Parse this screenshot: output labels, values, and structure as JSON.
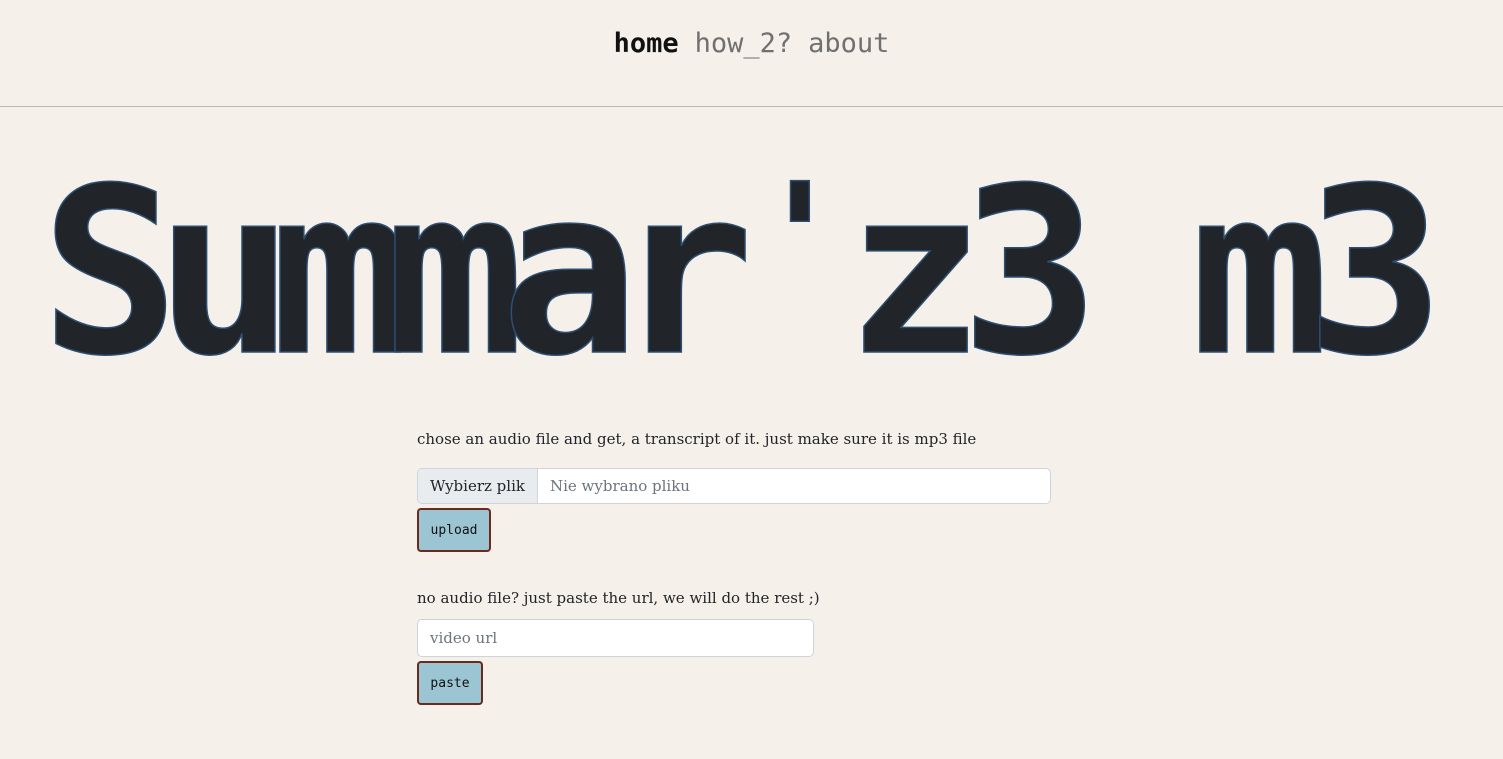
{
  "nav": {
    "items": [
      {
        "label": "home",
        "active": true
      },
      {
        "label": "how_2?",
        "active": false
      },
      {
        "label": "about",
        "active": false
      }
    ]
  },
  "hero": {
    "title_chars": [
      "S",
      "u",
      "m",
      "m",
      "a",
      "r",
      "'",
      "z",
      "3",
      " ",
      "m",
      "3"
    ]
  },
  "upload_section": {
    "help_text": "chose an audio file and get, a transcript of it. just make sure it is mp3 file",
    "file_button_label": "Wybierz plik",
    "file_status": "Nie wybrano pliku",
    "upload_label": "upload"
  },
  "url_section": {
    "help_text": "no audio file? just paste the url, we will do the rest ;)",
    "url_placeholder": "video url",
    "url_value": "",
    "paste_label": "paste"
  },
  "colors": {
    "background": "#f5f0e9",
    "button_fill": "#9cc5d4",
    "button_border": "#6b2a1e",
    "hero_text": "#212529"
  }
}
